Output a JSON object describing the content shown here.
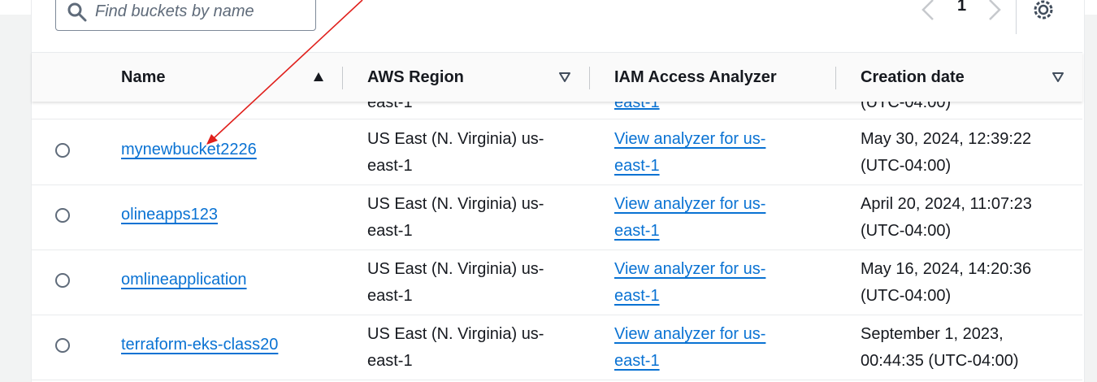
{
  "search": {
    "placeholder": "Find buckets by name"
  },
  "pagination": {
    "current_page": "1"
  },
  "table": {
    "columns": {
      "name": "Name",
      "region": "AWS Region",
      "analyzer": "IAM Access Analyzer",
      "created": "Creation date"
    },
    "partial_row": {
      "region": "east-1",
      "analyzer": "east-1",
      "created": "(UTC-04:00)"
    },
    "rows": [
      {
        "name": "mynewbucket2226",
        "region_line1": "US East (N. Virginia) us-",
        "region_line2": "east-1",
        "analyzer_line1": "View analyzer for us-",
        "analyzer_line2": "east-1",
        "created_line1": "May 30, 2024, 12:39:22",
        "created_line2": "(UTC-04:00)"
      },
      {
        "name": "olineapps123",
        "region_line1": "US East (N. Virginia) us-",
        "region_line2": "east-1",
        "analyzer_line1": "View analyzer for us-",
        "analyzer_line2": "east-1",
        "created_line1": "April 20, 2024, 11:07:23",
        "created_line2": "(UTC-04:00)"
      },
      {
        "name": "omlineapplication",
        "region_line1": "US East (N. Virginia) us-",
        "region_line2": "east-1",
        "analyzer_line1": "View analyzer for us-",
        "analyzer_line2": "east-1",
        "created_line1": "May 16, 2024, 14:20:36",
        "created_line2": "(UTC-04:00)"
      },
      {
        "name": "terraform-eks-class20",
        "region_line1": "US East (N. Virginia) us-",
        "region_line2": "east-1",
        "analyzer_line1": "View analyzer for us-",
        "analyzer_line2": "east-1",
        "created_line1": "September 1, 2023,",
        "created_line2": "00:44:35 (UTC-04:00)"
      }
    ]
  },
  "colors": {
    "link": "#0972d3",
    "annotation_arrow": "#e0201c",
    "header_bg": "#fafafa"
  },
  "icons": {
    "search": "search-icon",
    "prev": "chevron-left-icon",
    "next": "chevron-right-icon",
    "settings": "gear-icon",
    "sort_asc": "sort-ascending-icon",
    "sort_desc": "sort-descending-icon"
  }
}
